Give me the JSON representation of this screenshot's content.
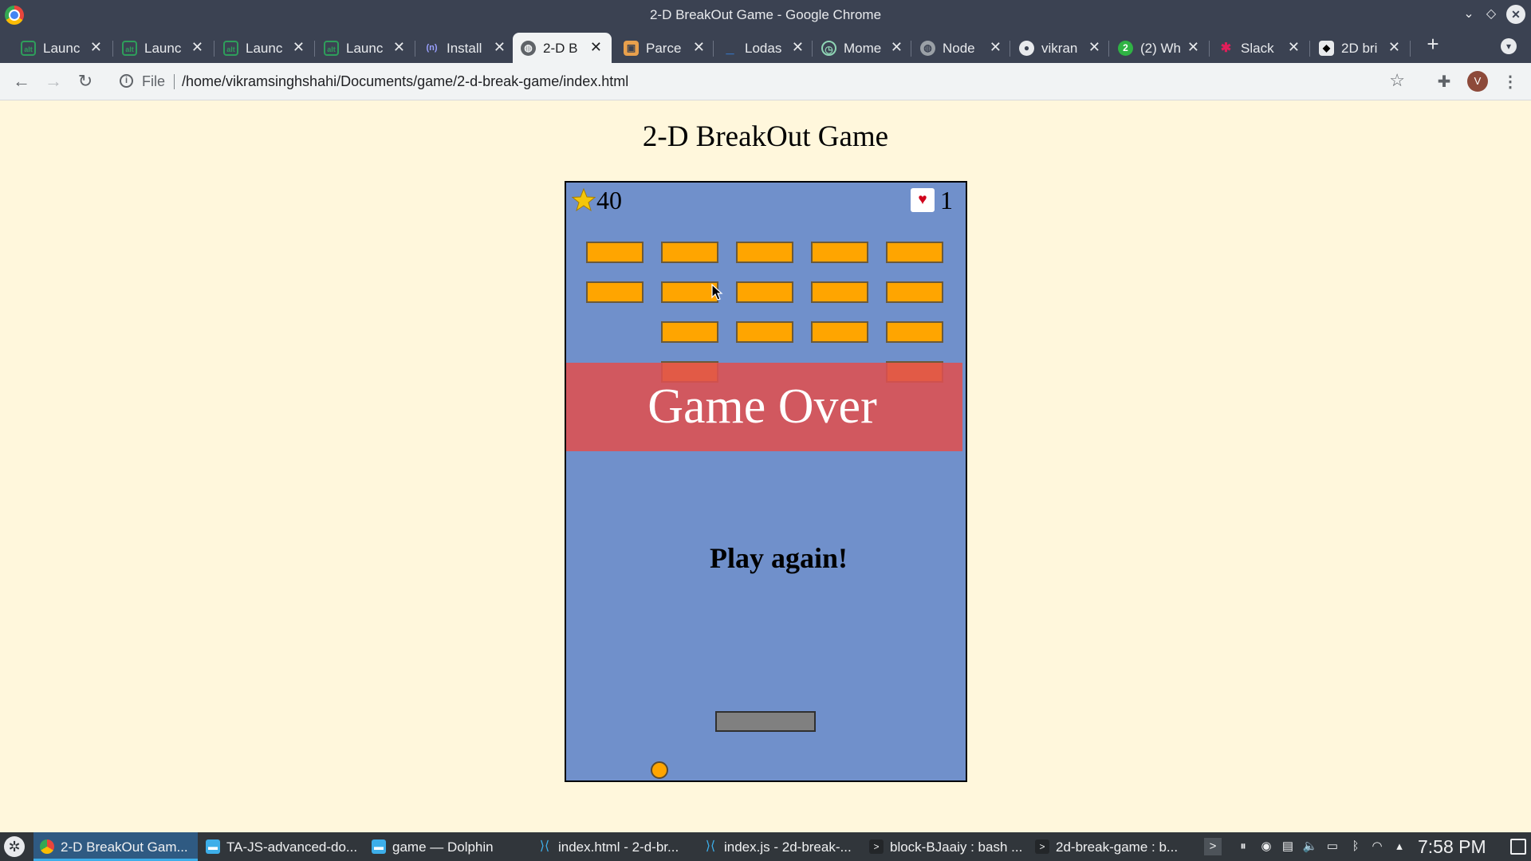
{
  "window": {
    "title": "2-D BreakOut Game - Google Chrome"
  },
  "tabs": [
    {
      "label": "Launc",
      "icon": "alt-icon",
      "active": false
    },
    {
      "label": "Launc",
      "icon": "alt-icon",
      "active": false
    },
    {
      "label": "Launc",
      "icon": "alt-icon",
      "active": false
    },
    {
      "label": "Launc",
      "icon": "alt-icon",
      "active": false
    },
    {
      "label": "Install",
      "icon": "n-icon",
      "active": false
    },
    {
      "label": "2-D B",
      "icon": "globe-icon",
      "active": true
    },
    {
      "label": "Parce",
      "icon": "box-icon",
      "active": false
    },
    {
      "label": "Lodas",
      "icon": "underscore-icon",
      "active": false
    },
    {
      "label": "Mome",
      "icon": "clock-icon",
      "active": false
    },
    {
      "label": "Node",
      "icon": "globe-icon",
      "active": false
    },
    {
      "label": "vikran",
      "icon": "github-icon",
      "active": false
    },
    {
      "label": "(2) Wh",
      "icon": "whatsapp-icon",
      "active": false
    },
    {
      "label": "Slack",
      "icon": "slack-icon",
      "active": false
    },
    {
      "label": "2D bri",
      "icon": "codepen-icon",
      "active": false
    }
  ],
  "toolbar": {
    "scheme": "File",
    "url": "/home/vikramsinghshahi/Documents/game/2-d-break-game/index.html",
    "avatar_initial": "V"
  },
  "page": {
    "heading": "2-D BreakOut Game",
    "game": {
      "score": "40",
      "lives": "1",
      "game_over": "Game Over",
      "play_again": "Play again!",
      "brick_grid": [
        [
          true,
          true,
          true,
          true,
          true
        ],
        [
          true,
          true,
          true,
          true,
          true
        ],
        [
          false,
          true,
          true,
          true,
          true
        ],
        [
          false,
          true,
          false,
          false,
          true
        ]
      ],
      "colors": {
        "canvas": "#7090cb",
        "brick": "#ffa500",
        "paddle": "#808080",
        "ball": "#ffa500",
        "overlay": "#de5050"
      }
    }
  },
  "taskbar": {
    "items": [
      {
        "label": "2-D BreakOut Gam...",
        "icon": "chrome-icon",
        "active": true
      },
      {
        "label": "TA-JS-advanced-do...",
        "icon": "folder-icon",
        "active": false
      },
      {
        "label": "game — Dolphin",
        "icon": "folder-icon",
        "active": false
      },
      {
        "label": "index.html - 2-d-br...",
        "icon": "vscode-icon",
        "active": false
      },
      {
        "label": "index.js - 2d-break-...",
        "icon": "vscode-icon",
        "active": false
      },
      {
        "label": "block-BJaaiy : bash ...",
        "icon": "terminal-icon",
        "active": false
      },
      {
        "label": "2d-break-game : b...",
        "icon": "terminal-icon",
        "active": false
      }
    ],
    "clock": "7:58 PM"
  }
}
